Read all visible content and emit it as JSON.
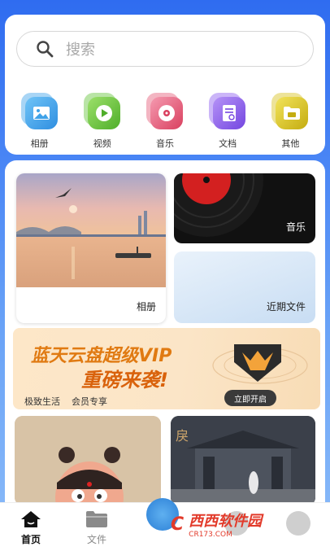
{
  "search": {
    "placeholder": "搜索"
  },
  "categories": [
    {
      "label": "相册",
      "icon": "image-icon",
      "color": "#3fa2e8"
    },
    {
      "label": "视频",
      "icon": "play-icon",
      "color": "#63c43a"
    },
    {
      "label": "音乐",
      "icon": "music-disc-icon",
      "color": "#e45a78"
    },
    {
      "label": "文档",
      "icon": "document-icon",
      "color": "#8b5cf0"
    },
    {
      "label": "其他",
      "icon": "folder-icon",
      "color": "#d8c21c"
    }
  ],
  "tiles": {
    "album_label": "相册",
    "music_label": "音乐",
    "recent_label": "近期文件"
  },
  "banner": {
    "title_line1": "蓝天云盘超级VIP",
    "title_line2": "重磅来袭!",
    "sub1": "极致生活",
    "sub2": "会员专享",
    "button": "立即开启"
  },
  "tabbar": {
    "home": "首页",
    "file": "文件"
  },
  "watermark": {
    "logo": "C",
    "name": "西西软件园",
    "url": "CR173.COM"
  }
}
